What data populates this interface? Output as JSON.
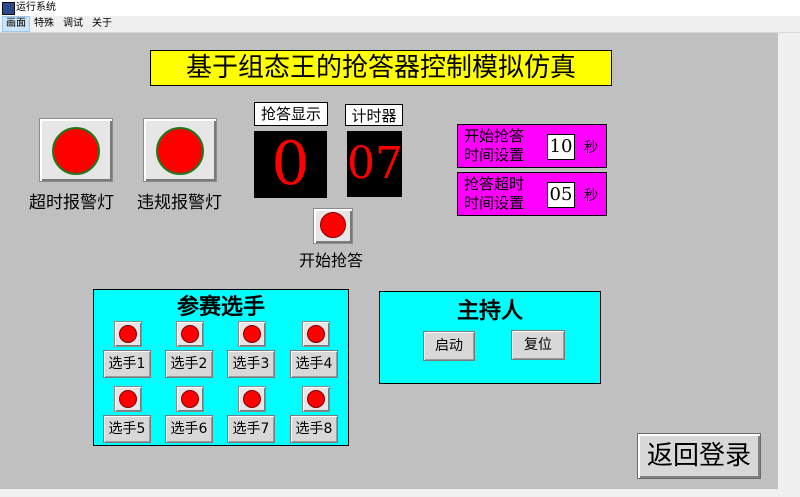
{
  "window": {
    "title": "运行系统"
  },
  "menu": [
    "画面",
    "特殊",
    "调试",
    "关于"
  ],
  "main_title": "基于组态王的抢答器控制模拟仿真",
  "lamps": {
    "timeout_label": "超时报警灯",
    "violation_label": "违规报警灯"
  },
  "display": {
    "answer_label": "抢答显示",
    "answer_value": "0",
    "timer_label": "计时器",
    "timer_value": "07"
  },
  "start": {
    "label": "开始抢答"
  },
  "settings": [
    {
      "line1": "开始抢答",
      "line2": "时间设置",
      "value": "10",
      "unit": "秒"
    },
    {
      "line1": "抢答超时",
      "line2": "时间设置",
      "value": "05",
      "unit": "秒"
    }
  ],
  "players_panel": {
    "title": "参赛选手",
    "players": [
      "选手1",
      "选手2",
      "选手3",
      "选手4",
      "选手5",
      "选手6",
      "选手7",
      "选手8"
    ]
  },
  "host_panel": {
    "title": "主持人",
    "start_label": "启动",
    "reset_label": "复位"
  },
  "return_label": "返回登录",
  "colors": {
    "canvas": "#c0c0c0",
    "title_bg": "#ffff00",
    "settings_bg": "#ff00ff",
    "panel_bg": "#00ffff",
    "lamp_red": "#ff0000",
    "display_bg": "#000000",
    "display_digits": "#ff0000"
  }
}
